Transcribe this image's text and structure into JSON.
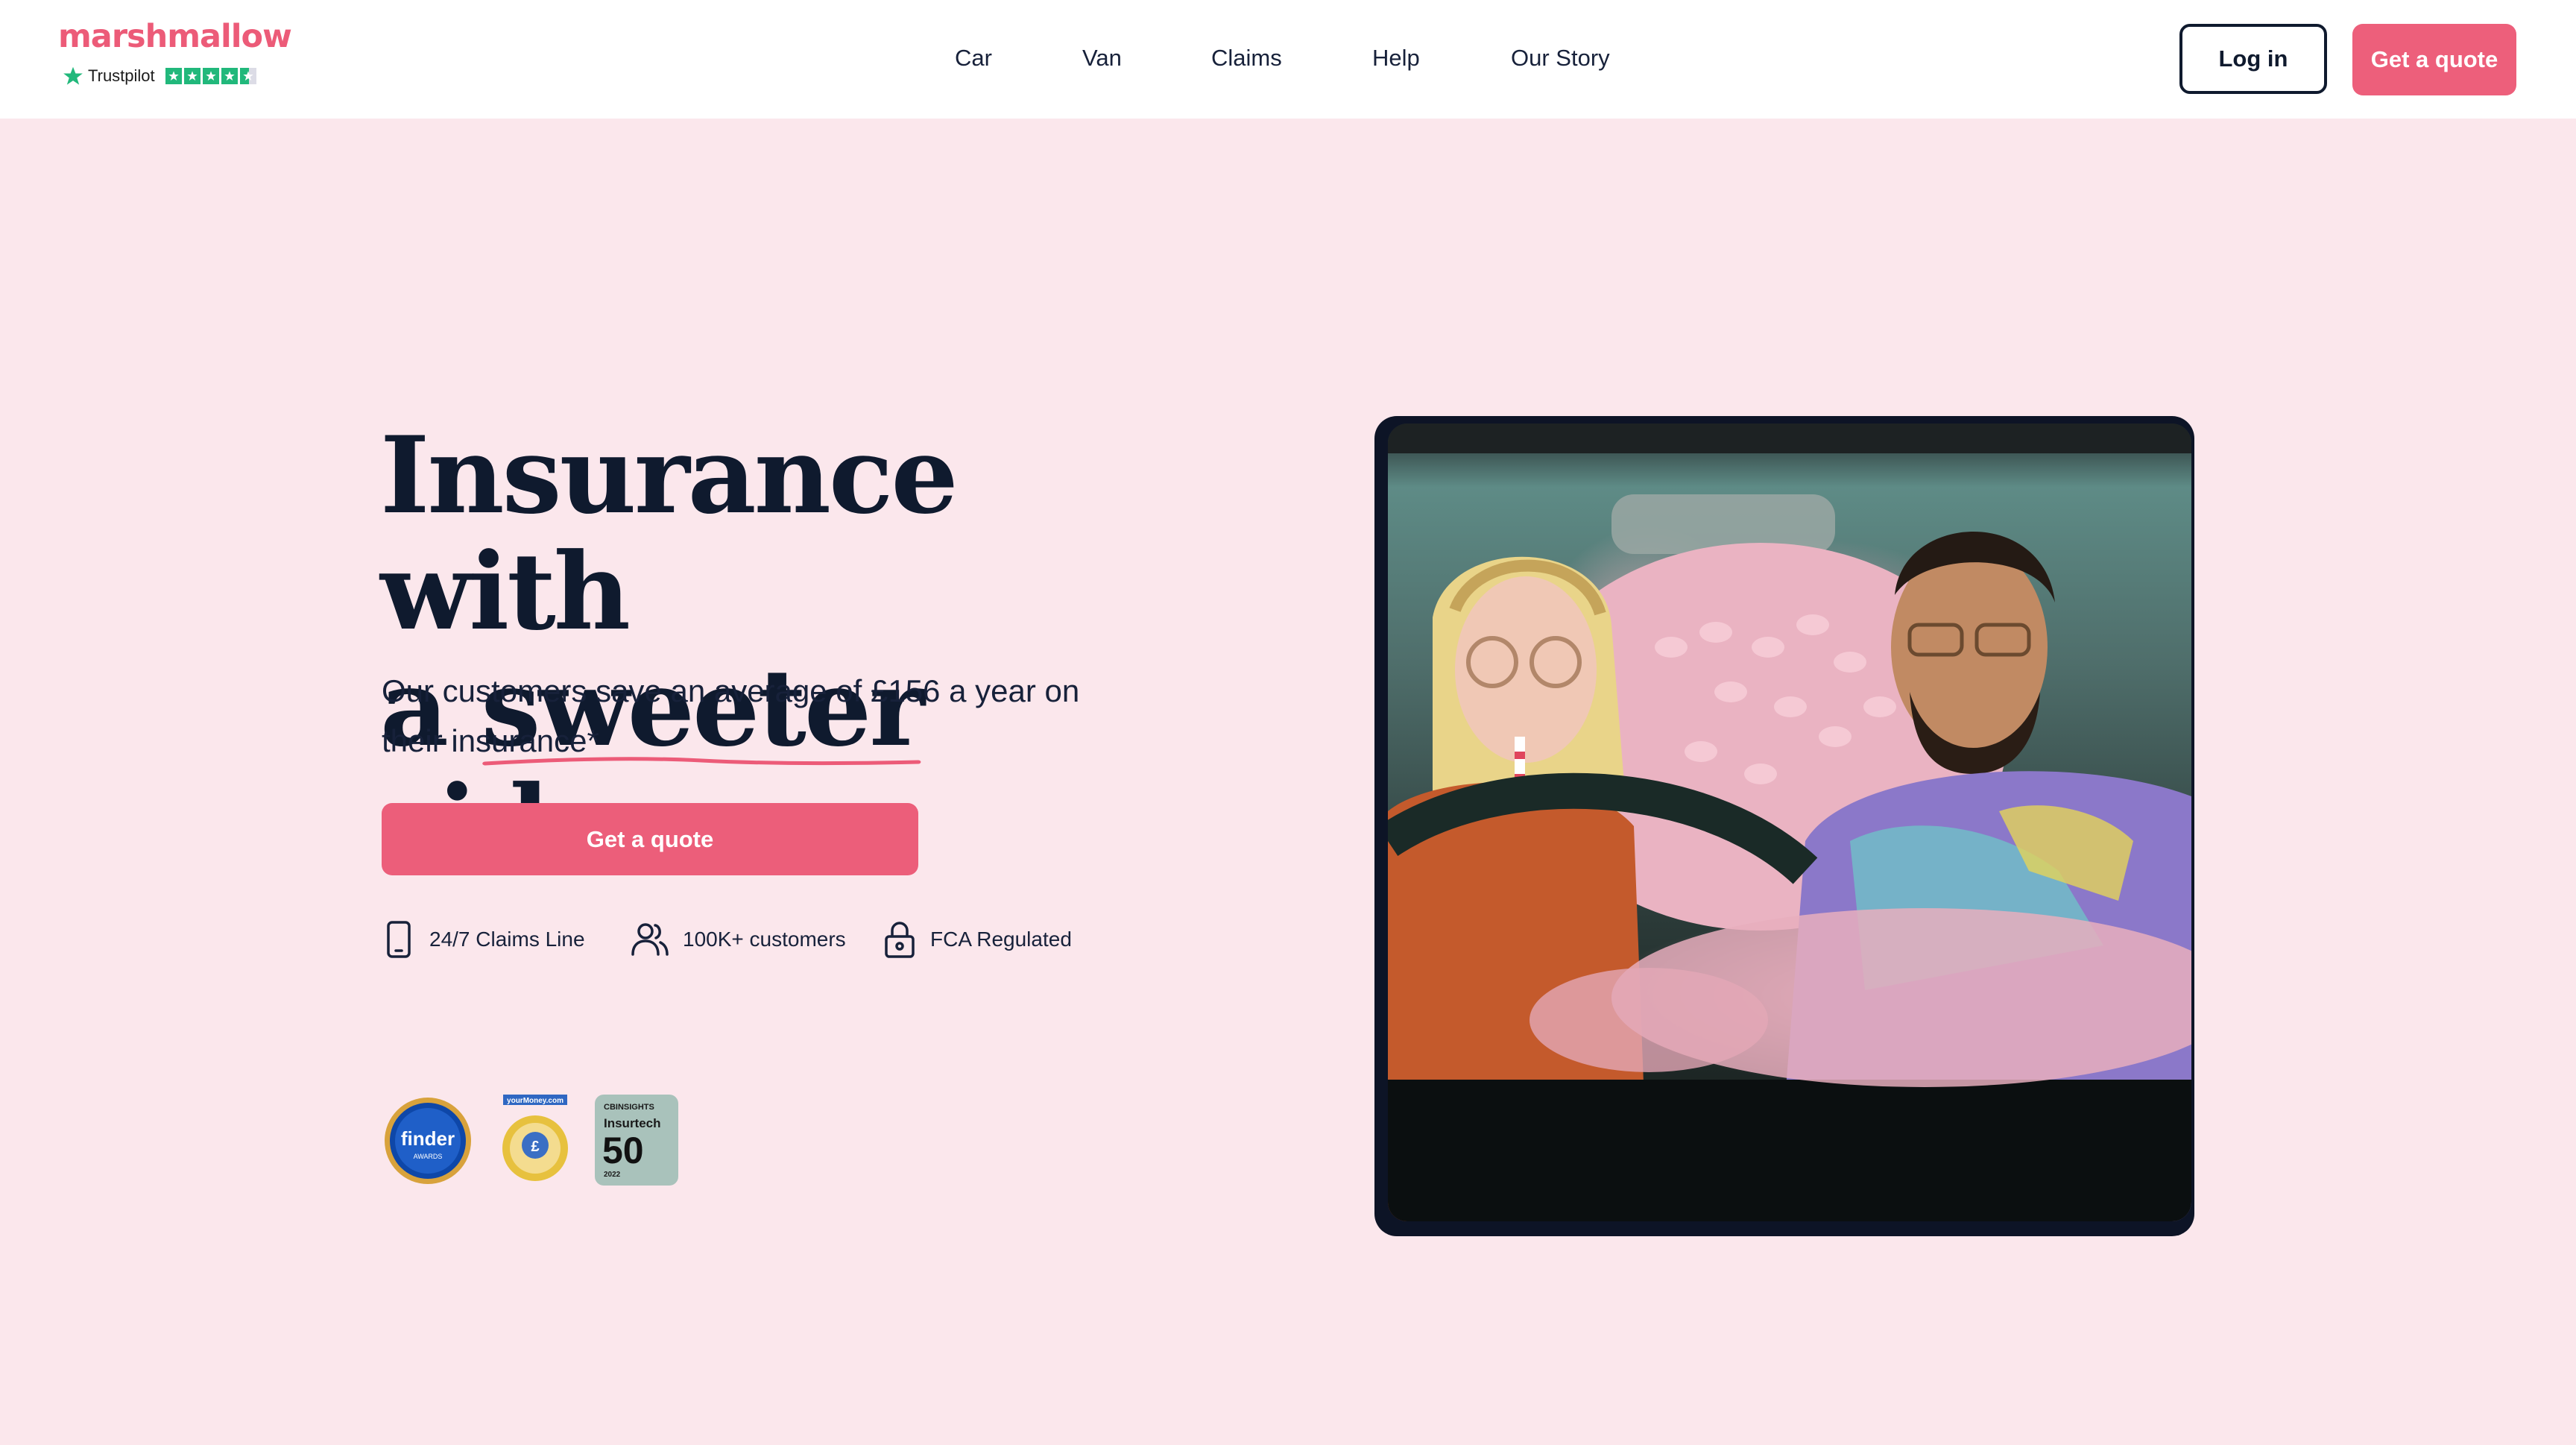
{
  "brand": {
    "logo": "marshmallow",
    "trustpilot_label": "Trustpilot",
    "trustpilot_rating": 4.5,
    "colors": {
      "brand_pink": "#ec5b78",
      "navy": "#0f1a2e",
      "background": "#fbe7ec",
      "trustpilot_green": "#21b87b"
    }
  },
  "nav": {
    "items": [
      "Car",
      "Van",
      "Claims",
      "Help",
      "Our Story"
    ],
    "login_label": "Log in",
    "quote_label": "Get a quote"
  },
  "hero": {
    "headline_line1": "Insurance with",
    "headline_a": "a",
    "headline_highlight": "sweeter",
    "headline_end": "side",
    "subtitle": "Our customers save an average of £156 a year on their insurance*",
    "cta_label": "Get a quote",
    "features": [
      {
        "icon": "phone-icon",
        "label": "24/7 Claims Line"
      },
      {
        "icon": "users-icon",
        "label": "100K+ customers"
      },
      {
        "icon": "lock-icon",
        "label": "FCA Regulated"
      }
    ],
    "awards": [
      {
        "icon": "finder-award-badge",
        "text": "finder",
        "subtext": "AWARDS"
      },
      {
        "icon": "yourmoney-award-badge",
        "text": "yourMoney.com",
        "subtext": "£"
      },
      {
        "icon": "cbinsights-award-badge",
        "text": "CBINSIGHTS",
        "title": "Insurtech",
        "number": "50",
        "year": "2022"
      }
    ]
  },
  "photo": {
    "icon": "hero-photo-people-in-car-with-marshmallows"
  }
}
